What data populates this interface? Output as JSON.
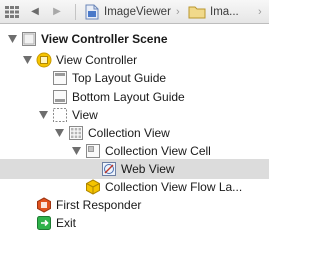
{
  "jumpbar": {
    "back_icon": "back-arrow-icon",
    "forward_icon": "forward-arrow-icon",
    "crumbs": [
      {
        "label": "ImageViewer",
        "icon": "project-file-icon"
      },
      {
        "label": "Ima...",
        "icon": "folder-icon"
      }
    ]
  },
  "outline": {
    "scene": {
      "label": "View Controller Scene",
      "expanded": true
    },
    "view_controller": {
      "label": "View Controller",
      "expanded": true
    },
    "top_layout_guide": {
      "label": "Top Layout Guide"
    },
    "bottom_layout_guide": {
      "label": "Bottom Layout Guide"
    },
    "view": {
      "label": "View",
      "expanded": true
    },
    "collection_view": {
      "label": "Collection View",
      "expanded": true
    },
    "collection_view_cell": {
      "label": "Collection View Cell",
      "expanded": true
    },
    "web_view": {
      "label": "Web View",
      "selected": true
    },
    "flow_layout": {
      "label": "Collection View Flow La..."
    },
    "first_responder": {
      "label": "First Responder"
    },
    "exit": {
      "label": "Exit"
    }
  },
  "colors": {
    "selection": "#dcdcdc",
    "view_controller_icon": "#f5c400",
    "first_responder_icon": "#e0521e",
    "exit_icon": "#2fb24a"
  }
}
